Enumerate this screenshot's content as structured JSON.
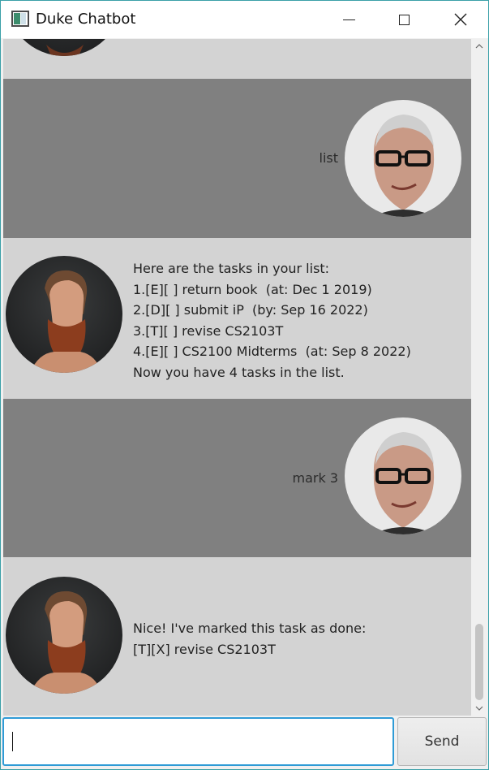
{
  "window": {
    "title": "Duke Chatbot"
  },
  "messages": [
    {
      "sender": "duke",
      "text": ""
    },
    {
      "sender": "user",
      "text": "list"
    },
    {
      "sender": "duke",
      "lines": [
        "Here are the tasks in your list:",
        "1.[E][ ] return book  (at: Dec 1 2019)",
        "2.[D][ ] submit iP  (by: Sep 16 2022)",
        "3.[T][ ] revise CS2103T",
        "4.[E][ ] CS2100 Midterms  (at: Sep 8 2022)",
        "Now you have 4 tasks in the list."
      ]
    },
    {
      "sender": "user",
      "text": "mark 3"
    },
    {
      "sender": "duke",
      "lines": [
        "Nice! I've marked this task as done:",
        "[T][X] revise CS2103T"
      ]
    }
  ],
  "input": {
    "value": "",
    "placeholder": ""
  },
  "send_button": {
    "label": "Send"
  },
  "icons": {
    "app": "app-window-icon",
    "minimize": "minimize-icon",
    "maximize": "maximize-icon",
    "close": "close-icon",
    "scroll_up": "chevron-up-icon",
    "scroll_down": "chevron-down-icon"
  },
  "colors": {
    "user_row_bg": "#808080",
    "duke_row_bg": "#d3d3d3",
    "input_focus_border": "#2f9bd6"
  }
}
